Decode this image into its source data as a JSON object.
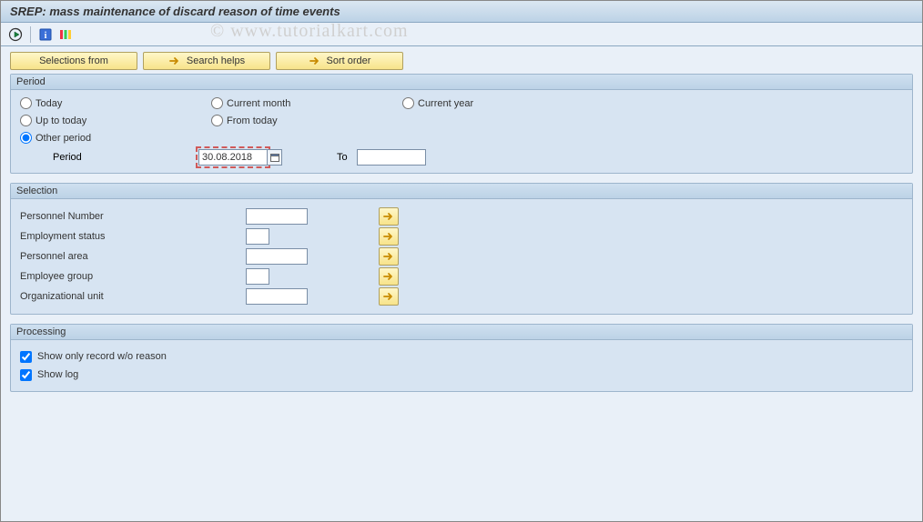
{
  "title": "SREP: mass maintenance of discard reason of time events",
  "watermark": "© www.tutorialkart.com",
  "buttons": {
    "selections_from": "Selections from",
    "search_helps": "Search helps",
    "sort_order": "Sort order"
  },
  "period": {
    "legend": "Period",
    "options": {
      "today": "Today",
      "current_month": "Current month",
      "current_year": "Current year",
      "up_to_today": "Up to today",
      "from_today": "From today",
      "other": "Other period"
    },
    "selected": "other",
    "period_label": "Period",
    "period_value": "30.08.2018",
    "to_label": "To",
    "to_value": ""
  },
  "selection": {
    "legend": "Selection",
    "rows": {
      "personnel_number": {
        "label": "Personnel Number",
        "value": "",
        "size": "md"
      },
      "employment_status": {
        "label": "Employment status",
        "value": "",
        "size": "sm"
      },
      "personnel_area": {
        "label": "Personnel area",
        "value": "",
        "size": "md"
      },
      "employee_group": {
        "label": "Employee group",
        "value": "",
        "size": "sm"
      },
      "organizational_unit": {
        "label": "Organizational unit",
        "value": "",
        "size": "md"
      }
    }
  },
  "processing": {
    "legend": "Processing",
    "show_only_no_reason": {
      "label": "Show only record w/o reason",
      "checked": true
    },
    "show_log": {
      "label": "Show log",
      "checked": true
    }
  }
}
